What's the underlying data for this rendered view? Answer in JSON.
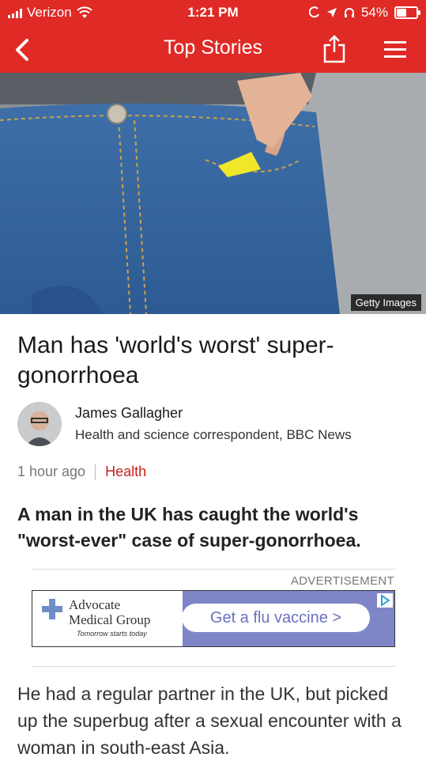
{
  "status_bar": {
    "carrier": "Verizon",
    "time": "1:21 PM",
    "battery": "54%",
    "battery_level": 0.54
  },
  "nav": {
    "title": "Top Stories",
    "back_icon": "chevron-left-icon",
    "share_icon": "share-icon",
    "menu_icon": "hamburger-menu-icon"
  },
  "hero": {
    "caption": "Getty Images"
  },
  "article": {
    "headline": "Man has 'world's worst' super-gonorrhoea",
    "author_name": "James Gallagher",
    "author_role": "Health and science correspondent, BBC News",
    "time_ago": "1 hour ago",
    "category": "Health",
    "summary": "A man in the UK has caught the world's \"worst-ever\" case of super-gonorrhoea.",
    "body": "He had a regular partner in the UK, but picked up the superbug after a sexual encounter with a woman in south-east Asia."
  },
  "ad": {
    "label": "ADVERTISEMENT",
    "brand_line1": "Advocate",
    "brand_line2": "Medical Group",
    "tagline": "Tomorrow starts today",
    "cta": "Get a flu vaccine >"
  },
  "colors": {
    "brand_red": "#e02a26",
    "category_red": "#c4211d",
    "ad_blue": "#7f86c8"
  }
}
